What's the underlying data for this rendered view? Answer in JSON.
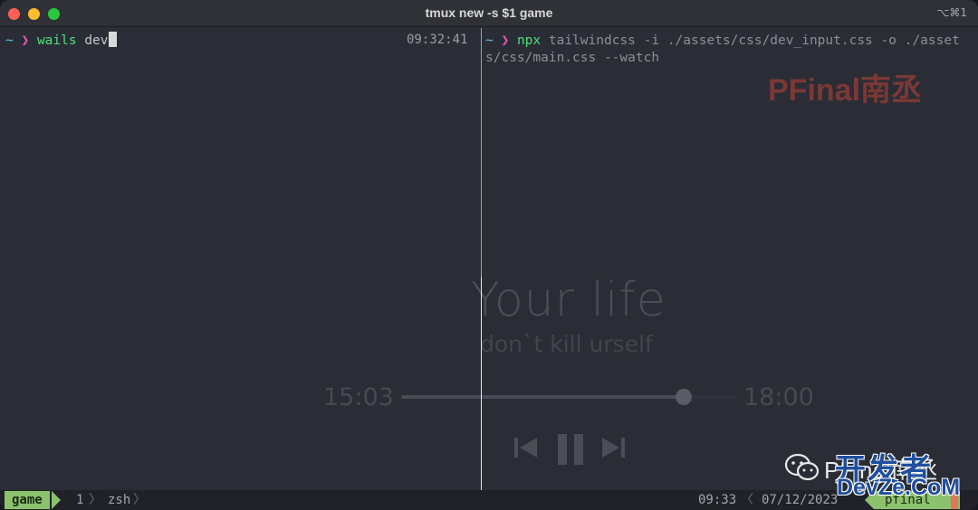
{
  "window": {
    "title": "tmux new -s $1 game",
    "shortcut": "⌥⌘1"
  },
  "left_pane": {
    "prompt_symbol": "~",
    "prompt_arrow": "❯",
    "command": "wails",
    "argument": " dev",
    "time": "09:32:41"
  },
  "right_pane": {
    "prompt_symbol": "~",
    "prompt_arrow": "❯",
    "command": "npx",
    "argument_line1": " tailwindcss -i ./assets/css/dev_input.css -o ./asset",
    "argument_line2": "s/css/main.css --watch"
  },
  "watermark": "PFinal南丞",
  "background_player": {
    "title": "Your life",
    "subtitle": "don`t kill urself",
    "elapsed": "15:03",
    "total": "18:00",
    "progress_fraction": 0.84
  },
  "statusbar": {
    "session": "game",
    "window_index": "1",
    "window_name": "zsh",
    "clock": "09:33",
    "date": "07/12/2023",
    "host": "pfinal"
  },
  "overlay": {
    "wechat_label": "PFinal南丞",
    "brand_cn": "开发者",
    "brand_en": "DevZe.CoM"
  },
  "colors": {
    "prompt_tilde": "#5ec4f0",
    "prompt_arrow": "#e55ab8",
    "command": "#4ee07a",
    "status_accent": "#8cc26e",
    "active_border": "#3ddc84"
  }
}
